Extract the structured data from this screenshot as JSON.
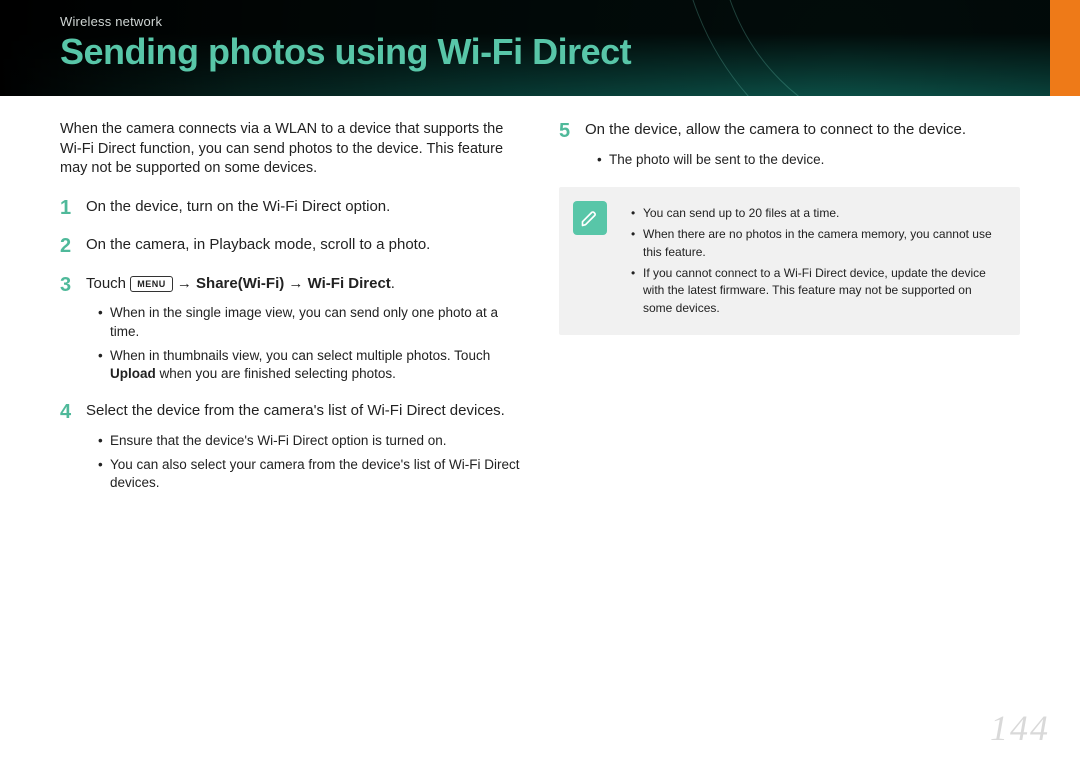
{
  "header": {
    "breadcrumb": "Wireless network",
    "title": "Sending photos using Wi-Fi Direct"
  },
  "intro": "When the camera connects via a WLAN to a device that supports the Wi-Fi Direct function, you can send photos to the device. This feature may not be supported on some devices.",
  "steps": {
    "s1": {
      "num": "1",
      "text": "On the device, turn on the Wi-Fi Direct option."
    },
    "s2": {
      "num": "2",
      "text": "On the camera, in Playback mode, scroll to a photo."
    },
    "s3": {
      "num": "3",
      "touch_label": "Touch",
      "menu_badge": "MENU",
      "arrow": " → ",
      "share_label": "Share(Wi-Fi)",
      "wifidirect_label": "Wi-Fi Direct",
      "period": ".",
      "sub": {
        "a": "When in the single image view, you can send only one photo at a time.",
        "b_prefix": "When in thumbnails view, you can select multiple photos. Touch ",
        "b_bold": "Upload",
        "b_suffix": " when you are finished selecting photos."
      }
    },
    "s4": {
      "num": "4",
      "text": "Select the device from the camera's list of Wi-Fi Direct devices.",
      "sub": {
        "a": "Ensure that the device's Wi-Fi Direct option is turned on.",
        "b": "You can also select your camera from the device's list of Wi-Fi Direct devices."
      }
    },
    "s5": {
      "num": "5",
      "text": "On the device, allow the camera to connect to the device.",
      "sub": {
        "a": "The photo will be sent to the device."
      }
    }
  },
  "note": {
    "items": {
      "a": "You can send up to 20 files at a time.",
      "b": "When there are no photos in the camera memory, you cannot use this feature.",
      "c": "If you cannot connect to a Wi-Fi Direct device, update the device with the latest firmware. This feature may not be supported on some devices."
    }
  },
  "page_number": "144"
}
